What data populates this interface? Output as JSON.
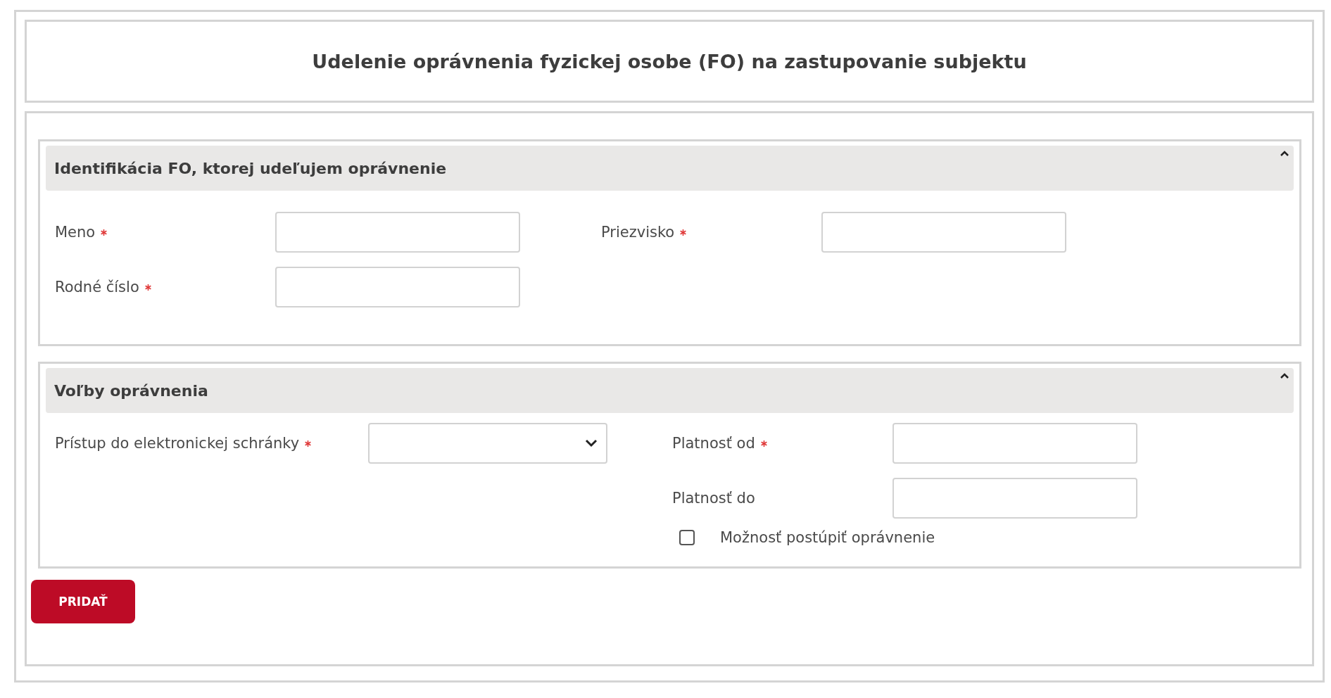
{
  "title": "Udelenie oprávnenia fyzickej osobe (FO) na zastupovanie subjektu",
  "sections": [
    {
      "title": "Identifikácia FO, ktorej udeľujem oprávnenie",
      "expanded": true,
      "columns": [
        [
          {
            "kind": "text",
            "label": "Meno",
            "required": true
          },
          {
            "kind": "text",
            "label": "Rodné číslo",
            "required": true
          }
        ],
        [
          {
            "kind": "text",
            "label": "Priezvisko",
            "required": true
          }
        ]
      ]
    },
    {
      "title": "Voľby oprávnenia",
      "expanded": true,
      "columns": [
        [
          {
            "kind": "select",
            "label": "Prístup do elektronickej schránky",
            "required": true
          }
        ],
        [
          {
            "kind": "text",
            "label": "Platnosť od",
            "required": true
          },
          {
            "kind": "text",
            "label": "Platnosť do",
            "required": false
          },
          {
            "kind": "checkbox",
            "label": "Možnosť postúpiť oprávnenie",
            "checked": false
          }
        ]
      ]
    }
  ],
  "submit_button": "PRIDAŤ"
}
